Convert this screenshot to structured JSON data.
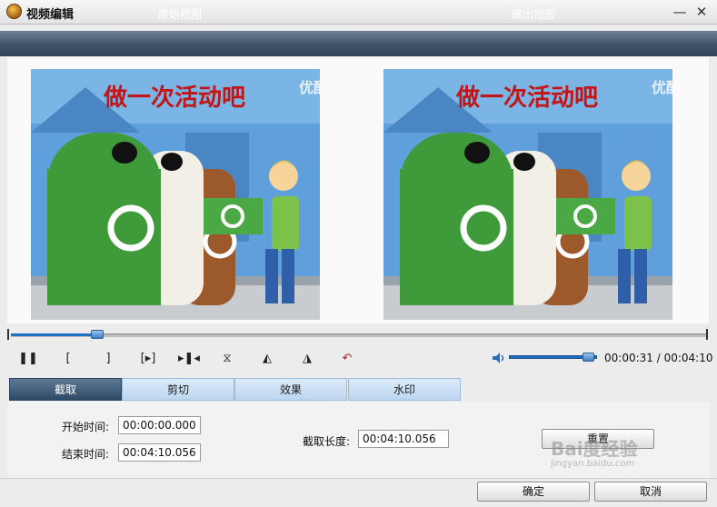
{
  "window": {
    "title": "视频编辑",
    "min_glyph": "—",
    "close_glyph": "✕"
  },
  "views": {
    "original": "原始视图",
    "output": "输出视图"
  },
  "preview": {
    "headline": "做一次活动吧",
    "logo": "优酷"
  },
  "timeline": {
    "progress": 0.124
  },
  "controls": {
    "pause": "❚❚",
    "mark_in": "[",
    "mark_out": "]",
    "step_fwd": "[▸]",
    "to_end": "▸❚◂",
    "flip": "⧖",
    "rot_left": "◭",
    "rot_right": "◮",
    "undo": "↶"
  },
  "volume": {
    "level": 0.9
  },
  "time": {
    "current": "00:00:31",
    "separator": " / ",
    "total": "00:04:10"
  },
  "tabs": [
    {
      "label": "截取",
      "active": true
    },
    {
      "label": "剪切",
      "active": false
    },
    {
      "label": "效果",
      "active": false
    },
    {
      "label": "水印",
      "active": false
    }
  ],
  "form": {
    "start_label": "开始时间:",
    "start_value": "00:00:00.000",
    "end_label": "结束时间:",
    "end_value": "00:04:10.056",
    "length_label": "截取长度:",
    "length_value": "00:04:10.056",
    "reset": "重置"
  },
  "footer": {
    "ok": "确定",
    "cancel": "取消"
  },
  "watermark": {
    "brand": "Bai度经验",
    "url": "jingyan.baidu.com"
  },
  "colors": {
    "accent": "#1e6fc4",
    "header": "#3f5266",
    "tab_active": "#2f4a66"
  }
}
